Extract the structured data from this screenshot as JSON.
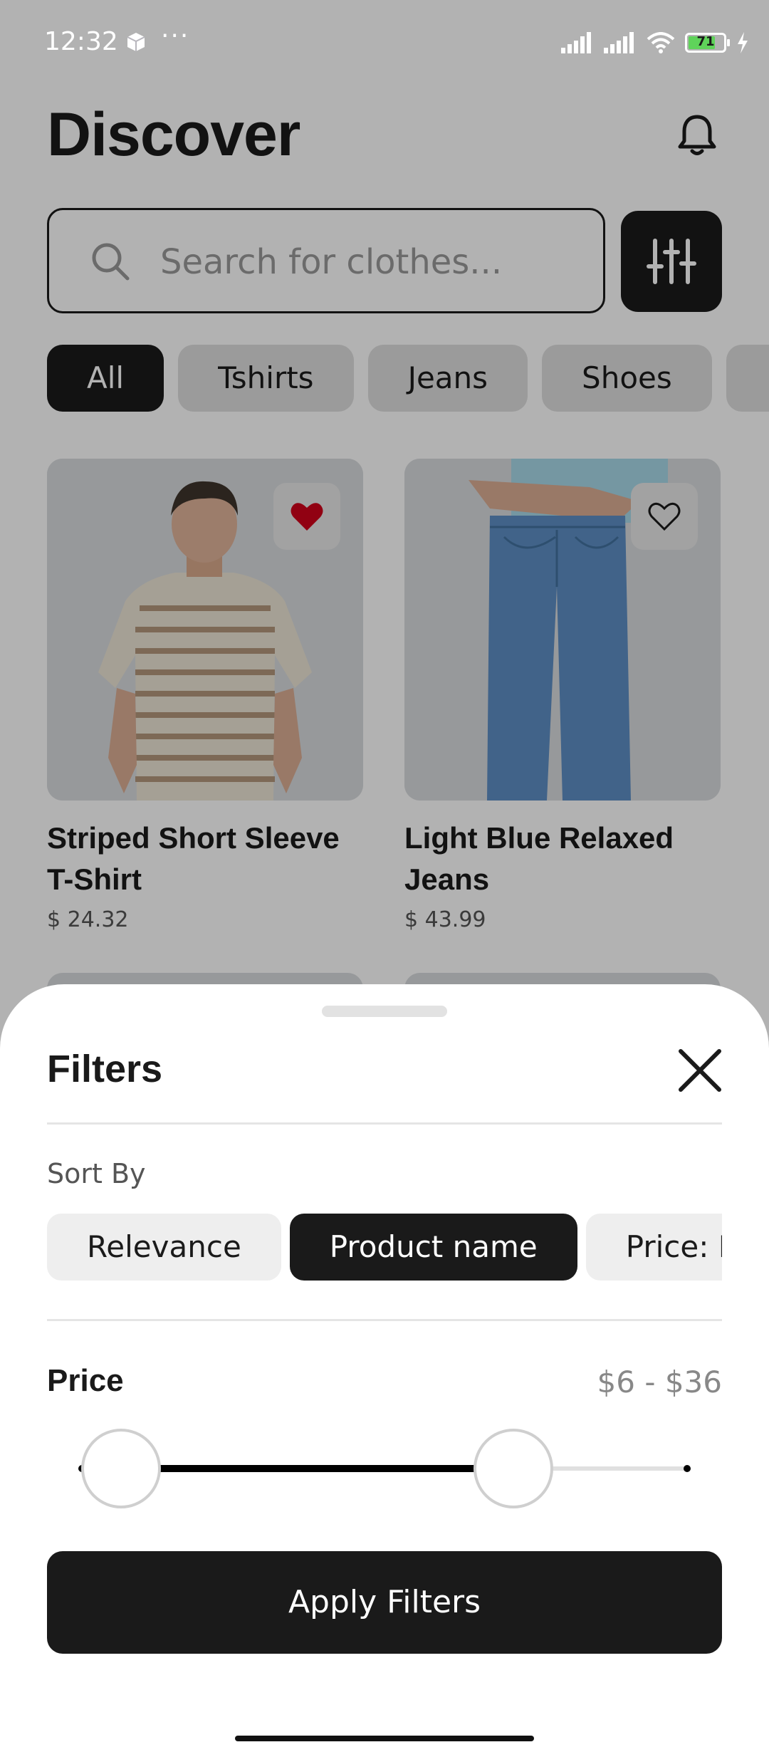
{
  "status_bar": {
    "time": "12:32",
    "dots": "···",
    "battery": "71",
    "battery_level": 0.71
  },
  "header": {
    "title": "Discover"
  },
  "search": {
    "placeholder": "Search for clothes..."
  },
  "categories": [
    "All",
    "Tshirts",
    "Jeans",
    "Shoes",
    ""
  ],
  "active_category": "All",
  "products": [
    {
      "name": "Striped Short Sleeve T-Shirt",
      "price": "$ 24.32",
      "favorited": true
    },
    {
      "name": "Light Blue Relaxed Jeans",
      "price": "$ 43.99",
      "favorited": false
    }
  ],
  "filters": {
    "title": "Filters",
    "sort_label": "Sort By",
    "sort_options": [
      "Relevance",
      "Product name",
      "Price: Lo"
    ],
    "selected_sort": "Product name",
    "price_label": "Price",
    "price_range": "$6 - $36",
    "price_low_fraction": 0.07,
    "price_high_fraction": 0.71,
    "apply_label": "Apply Filters"
  },
  "colors": {
    "accent": "#1a1a1a",
    "favorite": "#d0021b",
    "overlay": "rgba(0,0,0,0.30)"
  },
  "icons": [
    "box-icon",
    "signal-icon",
    "wifi-icon",
    "battery-icon",
    "charging-icon",
    "bell-icon",
    "search-icon",
    "sliders-icon",
    "heart-icon",
    "close-icon"
  ]
}
